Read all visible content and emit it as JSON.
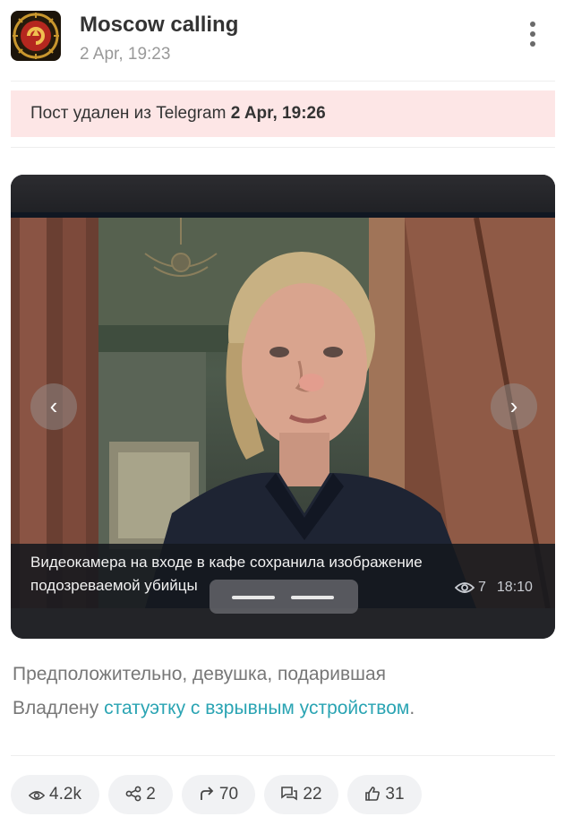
{
  "channel": {
    "name": "Moscow calling",
    "date": "2 Apr, 19:23"
  },
  "deleted_notice": {
    "text": "Пост удален из Telegram",
    "time": "2 Apr, 19:26"
  },
  "media": {
    "caption_line1": "Видеокамера на входе в кафе сохранила изображение",
    "caption_line2": "подозреваемой убийцы",
    "views": "7",
    "time": "18:10",
    "prev_arrow": "‹",
    "next_arrow": "›",
    "slide_count": 2,
    "active_slide": 1
  },
  "post": {
    "text_part1": "Предположительно, девушка, подарившая",
    "text_part2": "Владлену ",
    "link_text": "статуэтку с взрывным устройством",
    "text_end": "."
  },
  "stats": {
    "views": "4.2k",
    "shares": "2",
    "forwards": "70",
    "comments": "22",
    "likes": "31"
  },
  "colors": {
    "deleted_banner_bg": "#fde6e6",
    "link": "#2aa4b3",
    "stat_pill_bg": "#f1f2f4"
  }
}
